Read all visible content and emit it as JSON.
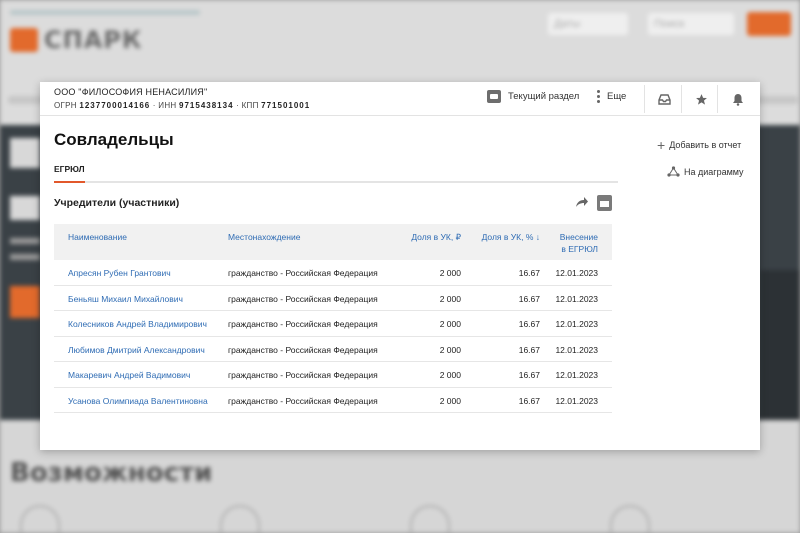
{
  "background": {
    "search_placeholder": "Даты",
    "search_placeholder2": "Поиск",
    "bottom_title": "Возможности",
    "logo_text": "СПАРК"
  },
  "company": {
    "name": "ООО \"ФИЛОСОФИЯ НЕНАСИЛИЯ\"",
    "ogrn_label": "ОГРН",
    "ogrn": "1237700014166",
    "inn_label": "ИНН",
    "inn": "9715438134",
    "kpp_label": "КПП",
    "kpp": "771501001"
  },
  "header": {
    "current_section_label": "Текущий раздел",
    "more_label": "Еще"
  },
  "page": {
    "title": "Совладельцы",
    "tab_active": "ЕГРЮЛ"
  },
  "side_actions": {
    "add_to_report": "Добавить в отчет",
    "to_diagram": "На диаграмму"
  },
  "section": {
    "title": "Учредители (участники)"
  },
  "table": {
    "headers": {
      "name": "Наименование",
      "location": "Местонахождение",
      "share_rub": "Доля в УК, ₽",
      "share_pct": "Доля в УК, % ↓",
      "date_line1": "Внесение",
      "date_line2": "в ЕГРЮЛ"
    },
    "rows": [
      {
        "name": "Апресян Рубен Грантович",
        "location": "гражданство - Российская Федерация",
        "share_rub": "2 000",
        "share_pct": "16.67",
        "date": "12.01.2023"
      },
      {
        "name": "Беньяш Михаил Михайлович",
        "location": "гражданство - Российская Федерация",
        "share_rub": "2 000",
        "share_pct": "16.67",
        "date": "12.01.2023"
      },
      {
        "name": "Колесников Андрей Владимирович",
        "location": "гражданство - Российская Федерация",
        "share_rub": "2 000",
        "share_pct": "16.67",
        "date": "12.01.2023"
      },
      {
        "name": "Любимов Дмитрий Александрович",
        "location": "гражданство - Российская Федерация",
        "share_rub": "2 000",
        "share_pct": "16.67",
        "date": "12.01.2023"
      },
      {
        "name": "Макаревич Андрей Вадимович",
        "location": "гражданство - Российская Федерация",
        "share_rub": "2 000",
        "share_pct": "16.67",
        "date": "12.01.2023"
      },
      {
        "name": "Усанова Олимпиада Валентиновна",
        "location": "гражданство - Российская Федерация",
        "share_rub": "2 000",
        "share_pct": "16.67",
        "date": "12.01.2023"
      }
    ]
  },
  "colors": {
    "accent": "#e2582b",
    "link": "#2f6cb4",
    "overlay": "#9a9a9a"
  }
}
